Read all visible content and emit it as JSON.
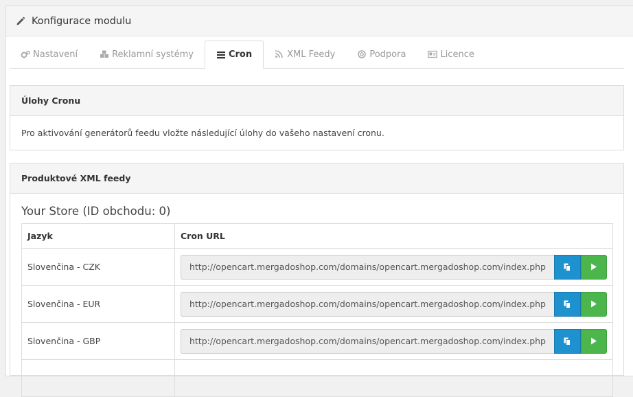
{
  "header": {
    "title": "Konfigurace modulu",
    "icon": "pencil-icon"
  },
  "tabs": [
    {
      "label": "Nastavení",
      "icon": "cogs-icon",
      "active": false
    },
    {
      "label": "Reklamní systémy",
      "icon": "cubes-icon",
      "active": false
    },
    {
      "label": "Cron",
      "icon": "tasks-icon",
      "active": true
    },
    {
      "label": "XML Feedy",
      "icon": "rss-icon",
      "active": false
    },
    {
      "label": "Podpora",
      "icon": "life-ring-icon",
      "active": false
    },
    {
      "label": "Licence",
      "icon": "id-card-icon",
      "active": false
    }
  ],
  "cron_section": {
    "title": "Úlohy Cronu",
    "description": "Pro aktivování generátorů feedu vložte následující úlohy do vašeho nastavení cronu."
  },
  "feeds_section": {
    "title": "Produktové XML feedy",
    "store_title": "Your Store (ID obchodu: 0)",
    "columns": [
      "Jazyk",
      "Cron URL"
    ],
    "rows": [
      {
        "language": "Slovenčina - CZK",
        "url": "http://opencart.mergadoshop.com/domains/opencart.mergadoshop.com/index.php"
      },
      {
        "language": "Slovenčina - EUR",
        "url": "http://opencart.mergadoshop.com/domains/opencart.mergadoshop.com/index.php"
      },
      {
        "language": "Slovenčina - GBP",
        "url": "http://opencart.mergadoshop.com/domains/opencart.mergadoshop.com/index.php"
      }
    ]
  },
  "colors": {
    "copy_button": "#1e91cf",
    "run_button": "#4cb64c"
  }
}
